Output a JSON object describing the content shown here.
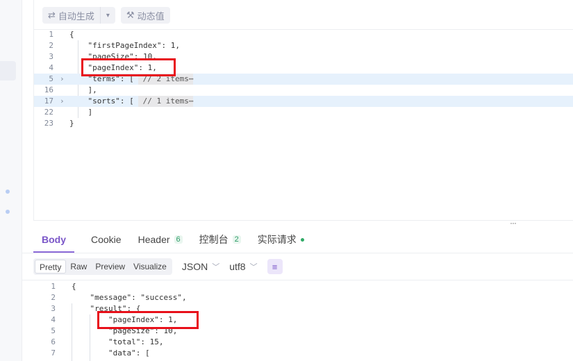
{
  "toolbar": {
    "auto_generate_label": "自动生成",
    "dynamic_value_label": "动态值"
  },
  "request_code": {
    "lines": [
      {
        "num": "1",
        "text": "{"
      },
      {
        "num": "2",
        "text": "    \"firstPageIndex\": 1,"
      },
      {
        "num": "3",
        "text": "    \"pageSize\": 10,"
      },
      {
        "num": "4",
        "text": "    \"pageIndex\": 1,"
      },
      {
        "num": "5",
        "text": "    \"terms\": [",
        "collapsed": " // 2 items⋯"
      },
      {
        "num": "16",
        "text": "    ],"
      },
      {
        "num": "17",
        "text": "    \"sorts\": [",
        "collapsed": " // 1 items⋯"
      },
      {
        "num": "22",
        "text": "    ]"
      },
      {
        "num": "23",
        "text": "}"
      }
    ]
  },
  "resizer_glyph": "···",
  "response_tabs": [
    {
      "label": "Body",
      "badge": ""
    },
    {
      "label": "Cookie",
      "badge": ""
    },
    {
      "label": "Header",
      "badge": "6"
    },
    {
      "label": "控制台",
      "badge": "2"
    },
    {
      "label": "实际请求",
      "badge": ""
    }
  ],
  "format_options": [
    "Pretty",
    "Raw",
    "Preview",
    "Visualize"
  ],
  "format_type": "JSON",
  "encoding": "utf8",
  "response_code": {
    "lines": [
      {
        "num": "1",
        "text": "{"
      },
      {
        "num": "2",
        "text": "    \"message\": \"success\","
      },
      {
        "num": "3",
        "text": "    \"result\": {"
      },
      {
        "num": "4",
        "text": "        \"pageIndex\": 1,"
      },
      {
        "num": "5",
        "text": "        \"pageSize\": 10,"
      },
      {
        "num": "6",
        "text": "        \"total\": 15,"
      },
      {
        "num": "7",
        "text": "        \"data\": ["
      }
    ]
  },
  "colors": {
    "accent": "#7a56c8",
    "highlight_box": "#e8101a",
    "badge_green": "#2d9c67"
  }
}
